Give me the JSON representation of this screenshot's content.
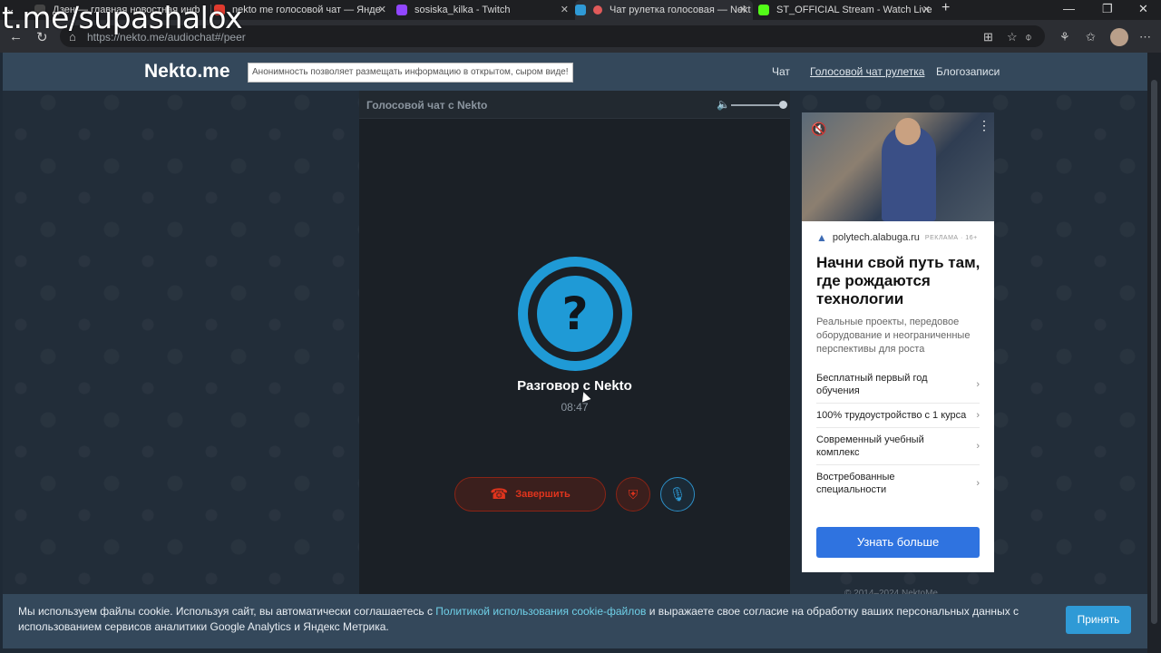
{
  "watermark": "t.me/supashalox",
  "browser": {
    "tabs": [
      {
        "title": "Дзен — главная новостная инф",
        "favicon_color": "#444444"
      },
      {
        "title": "nekto me голосовой чат — Янде",
        "favicon_color": "#e03a2e"
      },
      {
        "title": "sosiska_kilka - Twitch",
        "favicon_color": "#9146ff"
      },
      {
        "title": "Чат рулетка голосовая — Nekt",
        "favicon_color": "#e05a5a"
      },
      {
        "title": "ST_OFFICIAL Stream - Watch Live",
        "favicon_color": "#53fc18"
      }
    ],
    "close_glyph": "✕",
    "new_tab_glyph": "+",
    "url": "https://nekto.me/audiochat#/peer"
  },
  "header": {
    "logo": "Nekto.me",
    "slogan": "Анонимность позволяет размещать информацию в открытом, сыром виде!",
    "menu": [
      {
        "label": "Чат",
        "current": false
      },
      {
        "label": "Голосовой чат рулетка",
        "current": true
      },
      {
        "label": "Блогозаписи",
        "current": false
      }
    ]
  },
  "chat": {
    "title": "Голосовой чат с Nekto",
    "volume_level": 1.0,
    "avatar_glyph": "?",
    "conversation_title": "Разговор с Nekto",
    "timer": "08:47",
    "end_button_label": "Завершить"
  },
  "ad": {
    "domain": "polytech.alabuga.ru",
    "tag": "РЕКЛАМА · 16+",
    "headline": "Начни свой путь там, где рождаются технологии",
    "description": "Реальные проекты, передовое оборудование и неограниченные перспективы для роста",
    "items": [
      "Бесплатный первый год обучения",
      "100% трудоустройство с 1 курса",
      "Современный учебный комплекс",
      "Востребованные специальности"
    ],
    "cta": "Узнать больше"
  },
  "footer_copy": "© 2014–2024 NektoMe",
  "cookie": {
    "text_before": "Мы используем файлы cookie. Используя сайт, вы автоматически соглашаетесь с ",
    "link": "Политикой использования cookie-файлов",
    "text_after": " и выражаете свое согласие на обработку ваших персональных данных с использованием сервисов аналитики Google Analytics и Яндекс Метрика.",
    "accept": "Принять"
  },
  "colors": {
    "accent": "#1f9ad6",
    "danger": "#e0341d",
    "header_bg": "#34485b",
    "ad_cta": "#2f73e0"
  }
}
